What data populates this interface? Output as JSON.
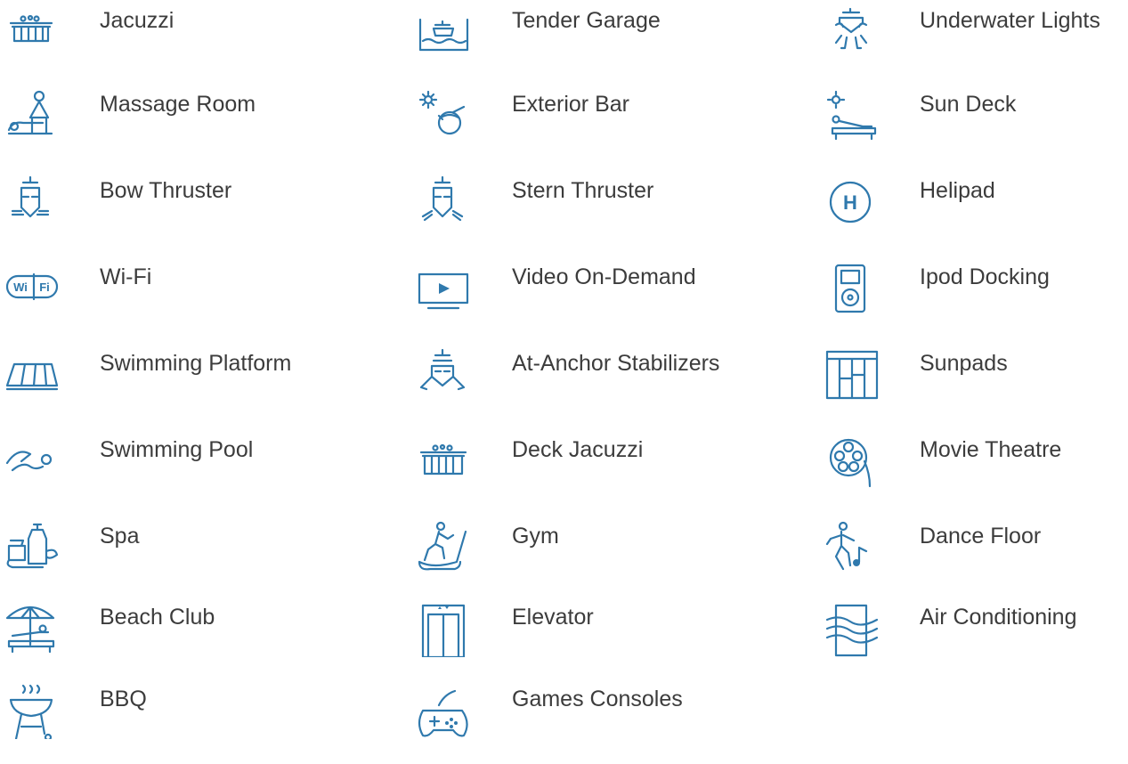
{
  "amenities": [
    {
      "label": "Jacuzzi",
      "icon": "jacuzzi-icon"
    },
    {
      "label": "Tender Garage",
      "icon": "tender-garage-icon"
    },
    {
      "label": "Underwater Lights",
      "icon": "underwater-lights-icon"
    },
    {
      "label": "Massage Room",
      "icon": "massage-room-icon"
    },
    {
      "label": "Exterior Bar",
      "icon": "exterior-bar-icon"
    },
    {
      "label": "Sun Deck",
      "icon": "sun-deck-icon"
    },
    {
      "label": "Bow Thruster",
      "icon": "bow-thruster-icon"
    },
    {
      "label": "Stern Thruster",
      "icon": "stern-thruster-icon"
    },
    {
      "label": "Helipad",
      "icon": "helipad-icon",
      "icon_text": "H"
    },
    {
      "label": "Wi-Fi",
      "icon": "wifi-icon",
      "icon_text_a": "Wi",
      "icon_text_b": "Fi"
    },
    {
      "label": "Video On-Demand",
      "icon": "video-on-demand-icon"
    },
    {
      "label": "Ipod Docking",
      "icon": "ipod-docking-icon"
    },
    {
      "label": "Swimming Platform",
      "icon": "swimming-platform-icon"
    },
    {
      "label": "At-Anchor Stabilizers",
      "icon": "at-anchor-stabilizers-icon"
    },
    {
      "label": "Sunpads",
      "icon": "sunpads-icon"
    },
    {
      "label": "Swimming Pool",
      "icon": "swimming-pool-icon"
    },
    {
      "label": "Deck Jacuzzi",
      "icon": "deck-jacuzzi-icon"
    },
    {
      "label": "Movie Theatre",
      "icon": "movie-theatre-icon"
    },
    {
      "label": "Spa",
      "icon": "spa-icon"
    },
    {
      "label": "Gym",
      "icon": "gym-icon"
    },
    {
      "label": "Dance Floor",
      "icon": "dance-floor-icon"
    },
    {
      "label": "Beach Club",
      "icon": "beach-club-icon"
    },
    {
      "label": "Elevator",
      "icon": "elevator-icon"
    },
    {
      "label": "Air Conditioning",
      "icon": "air-conditioning-icon"
    },
    {
      "label": "BBQ",
      "icon": "bbq-icon"
    },
    {
      "label": "Games Consoles",
      "icon": "games-consoles-icon"
    }
  ],
  "colors": {
    "icon": "#2f79ad",
    "text": "#3c3c3c",
    "background": "#ffffff"
  }
}
